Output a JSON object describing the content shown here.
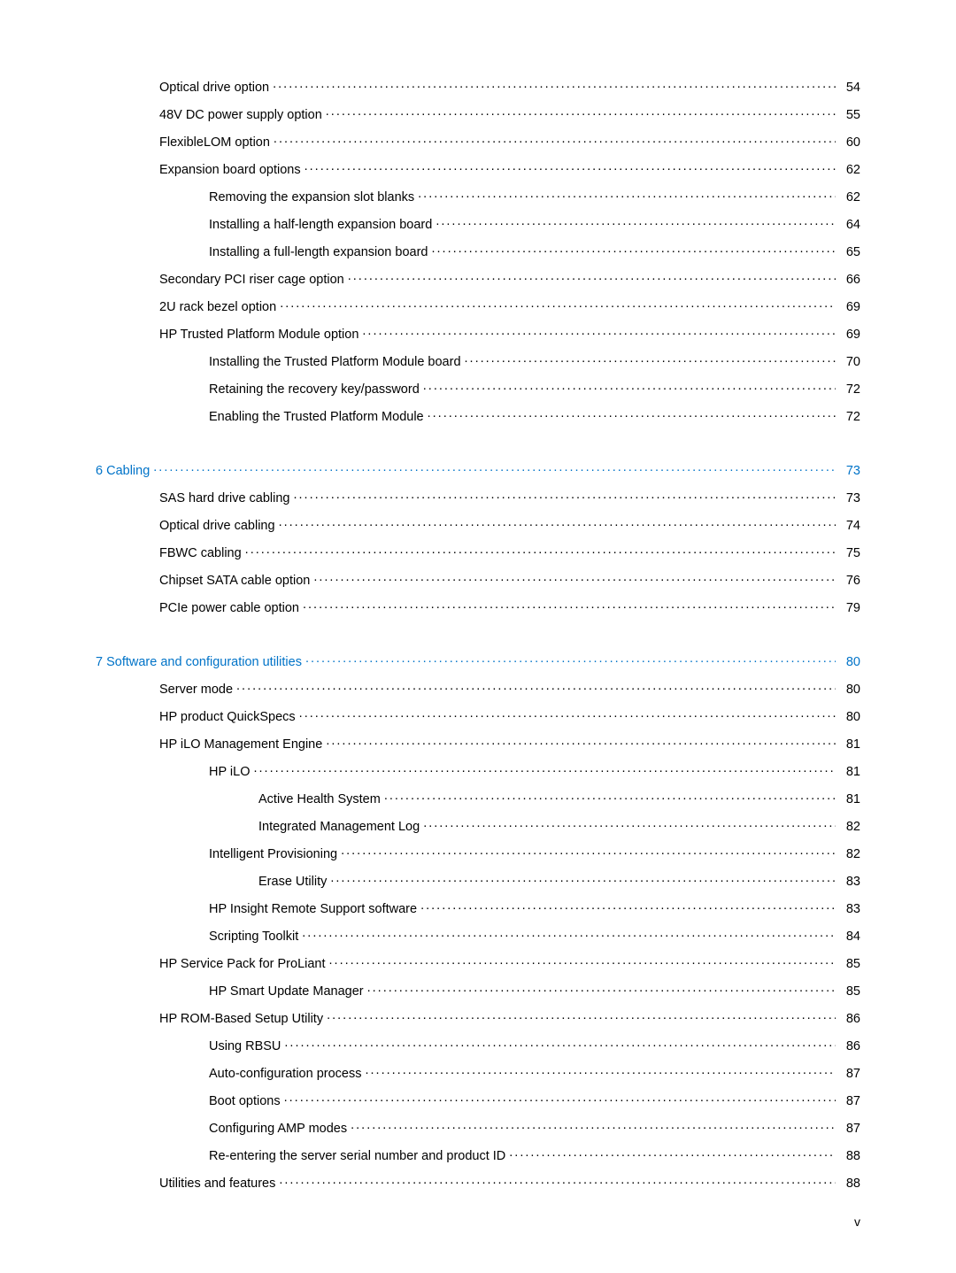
{
  "toc": [
    {
      "label": "Optical drive option",
      "page": "54",
      "indent": 1,
      "head": false
    },
    {
      "label": "48V DC power supply option",
      "page": "55",
      "indent": 1,
      "head": false
    },
    {
      "label": "FlexibleLOM option",
      "page": "60",
      "indent": 1,
      "head": false
    },
    {
      "label": "Expansion board options",
      "page": "62",
      "indent": 1,
      "head": false
    },
    {
      "label": "Removing the expansion slot blanks",
      "page": "62",
      "indent": 2,
      "head": false
    },
    {
      "label": "Installing a half-length expansion board",
      "page": "64",
      "indent": 2,
      "head": false
    },
    {
      "label": "Installing a full-length expansion board",
      "page": "65",
      "indent": 2,
      "head": false
    },
    {
      "label": "Secondary PCI riser cage option",
      "page": "66",
      "indent": 1,
      "head": false
    },
    {
      "label": "2U rack bezel option",
      "page": "69",
      "indent": 1,
      "head": false
    },
    {
      "label": "HP Trusted Platform Module option",
      "page": "69",
      "indent": 1,
      "head": false
    },
    {
      "label": "Installing the Trusted Platform Module board",
      "page": "70",
      "indent": 2,
      "head": false
    },
    {
      "label": "Retaining the recovery key/password",
      "page": "72",
      "indent": 2,
      "head": false
    },
    {
      "label": "Enabling the Trusted Platform Module",
      "page": "72",
      "indent": 2,
      "head": false
    },
    {
      "spacer": true
    },
    {
      "label": "6  Cabling",
      "page": "73",
      "indent": 0,
      "head": true
    },
    {
      "label": "SAS hard drive cabling",
      "page": "73",
      "indent": 1,
      "head": false
    },
    {
      "label": "Optical drive cabling",
      "page": "74",
      "indent": 1,
      "head": false
    },
    {
      "label": "FBWC cabling",
      "page": "75",
      "indent": 1,
      "head": false
    },
    {
      "label": "Chipset SATA cable option",
      "page": "76",
      "indent": 1,
      "head": false
    },
    {
      "label": "PCIe power cable option",
      "page": "79",
      "indent": 1,
      "head": false
    },
    {
      "spacer": true
    },
    {
      "label": "7  Software and configuration utilities",
      "page": "80",
      "indent": 0,
      "head": true
    },
    {
      "label": "Server mode",
      "page": "80",
      "indent": 1,
      "head": false
    },
    {
      "label": "HP product QuickSpecs",
      "page": "80",
      "indent": 1,
      "head": false
    },
    {
      "label": "HP iLO Management Engine",
      "page": "81",
      "indent": 1,
      "head": false
    },
    {
      "label": "HP iLO",
      "page": "81",
      "indent": 2,
      "head": false
    },
    {
      "label": "Active Health System",
      "page": "81",
      "indent": 3,
      "head": false
    },
    {
      "label": "Integrated Management Log",
      "page": "82",
      "indent": 3,
      "head": false
    },
    {
      "label": "Intelligent Provisioning",
      "page": "82",
      "indent": 2,
      "head": false
    },
    {
      "label": "Erase Utility",
      "page": "83",
      "indent": 3,
      "head": false
    },
    {
      "label": "HP Insight Remote Support software",
      "page": "83",
      "indent": 2,
      "head": false
    },
    {
      "label": "Scripting Toolkit",
      "page": "84",
      "indent": 2,
      "head": false
    },
    {
      "label": "HP Service Pack for ProLiant",
      "page": "85",
      "indent": 1,
      "head": false
    },
    {
      "label": "HP Smart Update Manager",
      "page": "85",
      "indent": 2,
      "head": false
    },
    {
      "label": "HP ROM-Based Setup Utility",
      "page": "86",
      "indent": 1,
      "head": false
    },
    {
      "label": "Using RBSU",
      "page": "86",
      "indent": 2,
      "head": false
    },
    {
      "label": "Auto-configuration process",
      "page": "87",
      "indent": 2,
      "head": false
    },
    {
      "label": "Boot options",
      "page": "87",
      "indent": 2,
      "head": false
    },
    {
      "label": "Configuring AMP modes",
      "page": "87",
      "indent": 2,
      "head": false
    },
    {
      "label": "Re-entering the server serial number and product ID",
      "page": "88",
      "indent": 2,
      "head": false
    },
    {
      "label": "Utilities and features",
      "page": "88",
      "indent": 1,
      "head": false
    }
  ],
  "footer": "v"
}
